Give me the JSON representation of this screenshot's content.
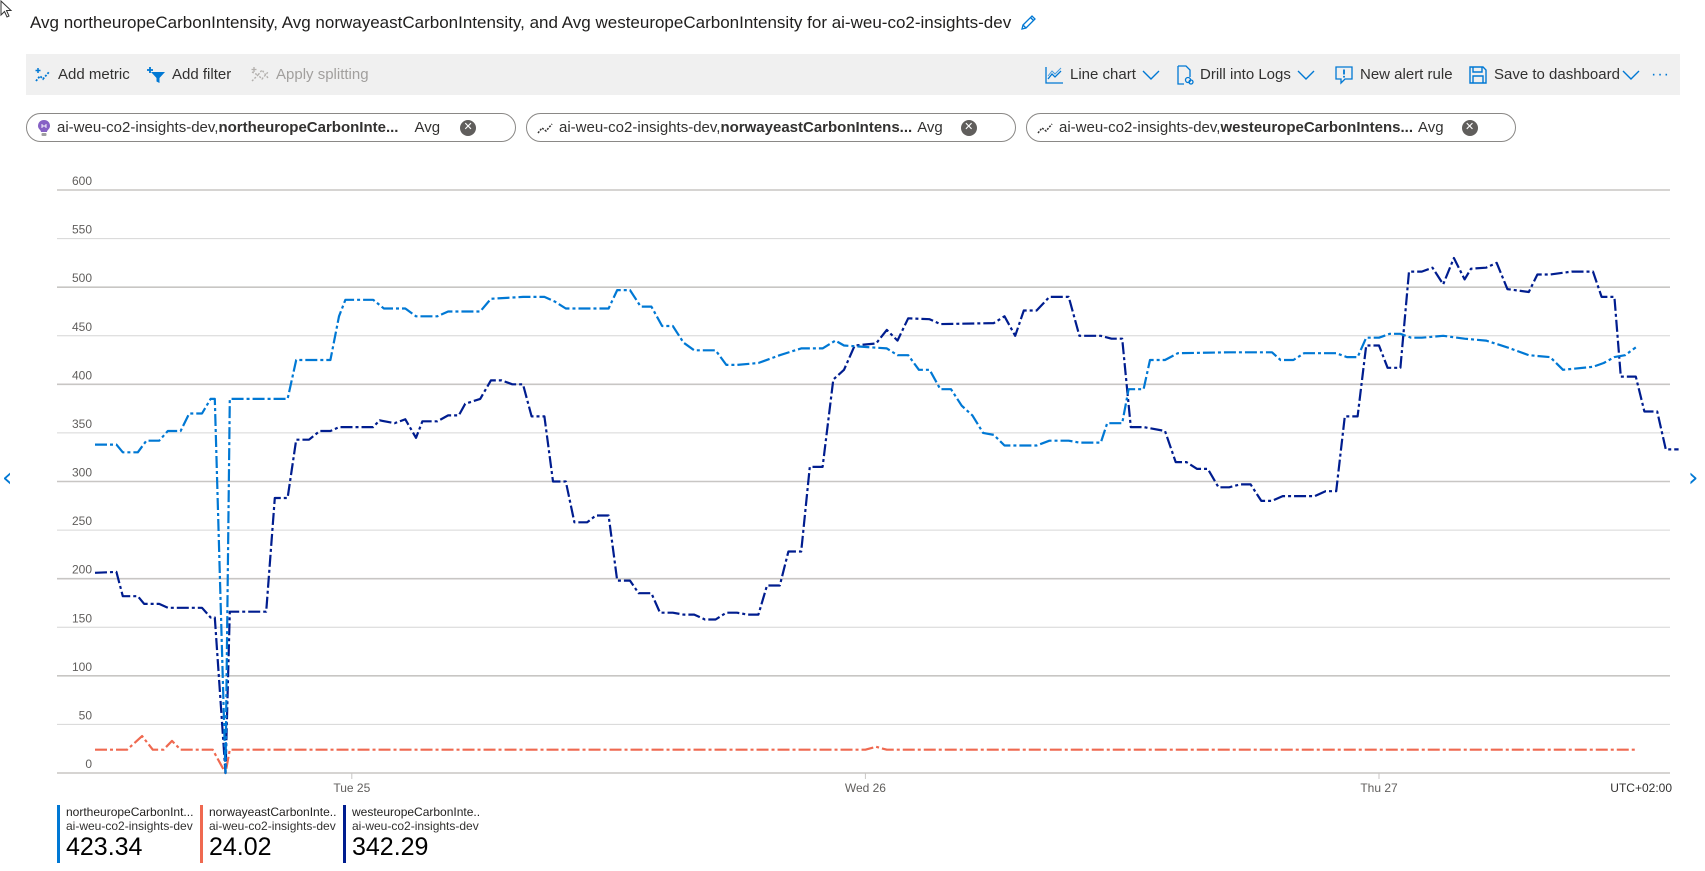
{
  "title": "Avg northeuropeCarbonIntensity, Avg norwayeastCarbonIntensity, and Avg westeuropeCarbonIntensity for ai-weu-co2-insights-dev",
  "toolbar": {
    "add_metric": "Add metric",
    "add_filter": "Add filter",
    "apply_splitting": "Apply splitting",
    "line_chart": "Line chart",
    "drill_into_logs": "Drill into Logs",
    "new_alert_rule": "New alert rule",
    "save_to_dashboard": "Save to dashboard",
    "more": "···"
  },
  "pills": [
    {
      "resource": "ai-weu-co2-insights-dev,",
      "metric": "northeuropeCarbonInte...",
      "agg": "Avg",
      "icon": "app-insights-icon"
    },
    {
      "resource": "ai-weu-co2-insights-dev,",
      "metric": "norwayeastCarbonIntens...",
      "agg": "Avg",
      "icon": "metric-line-icon"
    },
    {
      "resource": "ai-weu-co2-insights-dev,",
      "metric": "westeuropeCarbonIntens...",
      "agg": "Avg",
      "icon": "metric-line-icon"
    }
  ],
  "legend": [
    {
      "name": "northeuropeCarbonInt...",
      "resource": "ai-weu-co2-insights-dev",
      "value": "423.34",
      "color": "#0078d4"
    },
    {
      "name": "norwayeastCarbonInte...",
      "resource": "ai-weu-co2-insights-dev",
      "value": "24.02",
      "color": "#ef6950"
    },
    {
      "name": "westeuropeCarbonInte...",
      "resource": "ai-weu-co2-insights-dev",
      "value": "342.29",
      "color": "#001d8f"
    }
  ],
  "chart_data": {
    "type": "line",
    "title": "",
    "xlabel": "",
    "ylabel": "",
    "timezone_label": "UTC+02:00",
    "x_unit": "hours since Mon 24 12:00",
    "xlim": [
      0,
      72
    ],
    "x_ticks": [
      {
        "x": 12,
        "label": "Tue 25"
      },
      {
        "x": 36,
        "label": "Wed 26"
      },
      {
        "x": 60,
        "label": "Thu 27"
      }
    ],
    "ylim": [
      0,
      600
    ],
    "y_ticks": [
      0,
      50,
      100,
      150,
      200,
      250,
      300,
      350,
      400,
      450,
      500,
      550,
      600
    ],
    "grid": true,
    "legend_position": "bottom-left",
    "series": [
      {
        "name": "northeuropeCarbonIntensity",
        "color": "#0078d4",
        "points": [
          [
            0,
            338
          ],
          [
            1,
            338
          ],
          [
            1.3,
            330
          ],
          [
            2,
            330
          ],
          [
            2.4,
            342
          ],
          [
            3,
            342
          ],
          [
            3.4,
            352
          ],
          [
            4,
            352
          ],
          [
            4.4,
            370
          ],
          [
            5,
            370
          ],
          [
            5.4,
            385
          ],
          [
            5.6,
            385
          ],
          [
            6.1,
            0
          ],
          [
            6.3,
            385
          ],
          [
            9,
            385
          ],
          [
            9.4,
            425
          ],
          [
            11,
            425
          ],
          [
            11.4,
            470
          ],
          [
            11.7,
            487
          ],
          [
            13,
            487
          ],
          [
            13.5,
            478
          ],
          [
            14.5,
            478
          ],
          [
            15,
            470
          ],
          [
            16,
            470
          ],
          [
            16.5,
            475
          ],
          [
            18,
            475
          ],
          [
            18.5,
            488
          ],
          [
            20,
            490
          ],
          [
            21,
            490
          ],
          [
            21.5,
            485
          ],
          [
            22,
            478
          ],
          [
            24,
            478
          ],
          [
            24.4,
            497
          ],
          [
            25,
            497
          ],
          [
            25.5,
            480
          ],
          [
            26,
            480
          ],
          [
            26.5,
            460
          ],
          [
            27,
            460
          ],
          [
            27.5,
            443
          ],
          [
            28,
            435
          ],
          [
            29,
            435
          ],
          [
            29.5,
            420
          ],
          [
            30,
            420
          ],
          [
            31,
            422
          ],
          [
            32,
            430
          ],
          [
            33,
            437
          ],
          [
            34,
            437
          ],
          [
            34.6,
            445
          ],
          [
            35,
            440
          ],
          [
            37,
            437
          ],
          [
            37.5,
            430
          ],
          [
            38,
            430
          ],
          [
            38.5,
            415
          ],
          [
            39,
            415
          ],
          [
            39.5,
            395
          ],
          [
            40,
            395
          ],
          [
            40.5,
            378
          ],
          [
            41,
            368
          ],
          [
            41.5,
            350
          ],
          [
            42,
            348
          ],
          [
            42.5,
            337
          ],
          [
            44,
            337
          ],
          [
            44.6,
            342
          ],
          [
            45.5,
            342
          ],
          [
            46,
            340
          ],
          [
            47,
            340
          ],
          [
            47.3,
            360
          ],
          [
            48,
            360
          ],
          [
            48.3,
            395
          ],
          [
            49,
            395
          ],
          [
            49.3,
            425
          ],
          [
            50,
            425
          ],
          [
            50.6,
            432
          ],
          [
            53,
            433
          ],
          [
            55,
            433
          ],
          [
            55.4,
            425
          ],
          [
            56,
            425
          ],
          [
            56.5,
            432
          ],
          [
            58,
            432
          ],
          [
            58.5,
            428
          ],
          [
            59,
            428
          ],
          [
            59.4,
            448
          ],
          [
            60,
            448
          ],
          [
            60.5,
            452
          ],
          [
            61,
            452
          ],
          [
            61.5,
            448
          ],
          [
            62,
            448
          ],
          [
            63,
            450
          ],
          [
            64,
            447
          ],
          [
            65,
            445
          ],
          [
            66,
            438
          ],
          [
            67,
            430
          ],
          [
            68,
            428
          ],
          [
            68.6,
            415
          ],
          [
            70,
            418
          ],
          [
            70.5,
            422
          ],
          [
            71,
            428
          ],
          [
            71.5,
            430
          ],
          [
            72,
            438
          ]
        ]
      },
      {
        "name": "norwayeastCarbonIntensity",
        "color": "#ef6950",
        "points": [
          [
            0,
            24
          ],
          [
            1.5,
            24
          ],
          [
            2.2,
            38
          ],
          [
            2.7,
            24
          ],
          [
            3.2,
            24
          ],
          [
            3.6,
            33
          ],
          [
            4,
            24
          ],
          [
            5.5,
            24
          ],
          [
            6.1,
            0
          ],
          [
            6.3,
            24
          ],
          [
            36,
            24
          ],
          [
            36.5,
            27
          ],
          [
            37,
            24
          ],
          [
            72,
            24
          ]
        ]
      },
      {
        "name": "westeuropeCarbonIntensity",
        "color": "#001d8f",
        "points": [
          [
            0,
            206
          ],
          [
            1,
            207
          ],
          [
            1.3,
            182
          ],
          [
            2,
            182
          ],
          [
            2.3,
            174
          ],
          [
            3,
            174
          ],
          [
            3.4,
            170
          ],
          [
            5,
            170
          ],
          [
            5.4,
            160
          ],
          [
            5.6,
            160
          ],
          [
            6.1,
            0
          ],
          [
            6.3,
            166
          ],
          [
            8,
            166
          ],
          [
            8.4,
            283
          ],
          [
            9,
            283
          ],
          [
            9.4,
            343
          ],
          [
            10,
            343
          ],
          [
            10.5,
            352
          ],
          [
            11,
            352
          ],
          [
            11.4,
            356
          ],
          [
            13,
            356
          ],
          [
            13.3,
            363
          ],
          [
            14,
            360
          ],
          [
            14.5,
            364
          ],
          [
            15,
            345
          ],
          [
            15.3,
            362
          ],
          [
            16,
            362
          ],
          [
            16.5,
            368
          ],
          [
            17,
            368
          ],
          [
            17.3,
            380
          ],
          [
            18,
            385
          ],
          [
            18.5,
            404
          ],
          [
            19,
            404
          ],
          [
            19.5,
            400
          ],
          [
            20,
            400
          ],
          [
            20.4,
            367
          ],
          [
            21,
            367
          ],
          [
            21.4,
            300
          ],
          [
            22,
            300
          ],
          [
            22.4,
            258
          ],
          [
            23,
            258
          ],
          [
            23.4,
            265
          ],
          [
            24,
            265
          ],
          [
            24.4,
            198
          ],
          [
            25,
            198
          ],
          [
            25.4,
            185
          ],
          [
            26,
            185
          ],
          [
            26.4,
            165
          ],
          [
            27,
            165
          ],
          [
            27.5,
            163
          ],
          [
            28,
            163
          ],
          [
            28.5,
            158
          ],
          [
            29,
            158
          ],
          [
            29.5,
            165
          ],
          [
            30,
            165
          ],
          [
            30.5,
            163
          ],
          [
            31,
            163
          ],
          [
            31.4,
            193
          ],
          [
            32,
            193
          ],
          [
            32.4,
            228
          ],
          [
            33,
            228
          ],
          [
            33.4,
            315
          ],
          [
            34,
            315
          ],
          [
            34.5,
            405
          ],
          [
            35,
            415
          ],
          [
            35.5,
            440
          ],
          [
            36.5,
            442
          ],
          [
            37,
            456
          ],
          [
            37.5,
            445
          ],
          [
            38,
            468
          ],
          [
            39,
            467
          ],
          [
            39.5,
            462
          ],
          [
            42,
            463
          ],
          [
            42.5,
            470
          ],
          [
            43,
            450
          ],
          [
            43.4,
            476
          ],
          [
            44,
            476
          ],
          [
            44.6,
            490
          ],
          [
            45.5,
            490
          ],
          [
            46,
            450
          ],
          [
            47,
            450
          ],
          [
            47.5,
            447
          ],
          [
            48,
            447
          ],
          [
            48.4,
            356
          ],
          [
            49,
            356
          ],
          [
            50,
            352
          ],
          [
            50.5,
            320
          ],
          [
            51,
            320
          ],
          [
            51.5,
            313
          ],
          [
            52,
            313
          ],
          [
            52.5,
            294
          ],
          [
            53,
            294
          ],
          [
            53.5,
            297
          ],
          [
            54,
            297
          ],
          [
            54.5,
            280
          ],
          [
            55,
            280
          ],
          [
            55.5,
            285
          ],
          [
            57,
            285
          ],
          [
            57.5,
            290
          ],
          [
            58,
            290
          ],
          [
            58.4,
            367
          ],
          [
            59,
            367
          ],
          [
            59.4,
            440
          ],
          [
            60,
            440
          ],
          [
            60.4,
            417
          ],
          [
            61,
            417
          ],
          [
            61.4,
            516
          ],
          [
            62,
            516
          ],
          [
            62.5,
            520
          ],
          [
            63,
            503
          ],
          [
            63.5,
            530
          ],
          [
            64,
            508
          ],
          [
            64.3,
            519
          ],
          [
            65,
            520
          ],
          [
            65.5,
            525
          ],
          [
            66,
            498
          ],
          [
            67,
            495
          ],
          [
            67.4,
            513
          ],
          [
            68,
            513
          ],
          [
            69,
            516
          ],
          [
            70,
            516
          ],
          [
            70.4,
            490
          ],
          [
            71,
            490
          ],
          [
            71.3,
            408
          ],
          [
            72,
            408
          ],
          [
            72.4,
            372
          ],
          [
            73,
            372
          ],
          [
            73.4,
            333
          ],
          [
            74,
            333
          ]
        ]
      }
    ]
  }
}
